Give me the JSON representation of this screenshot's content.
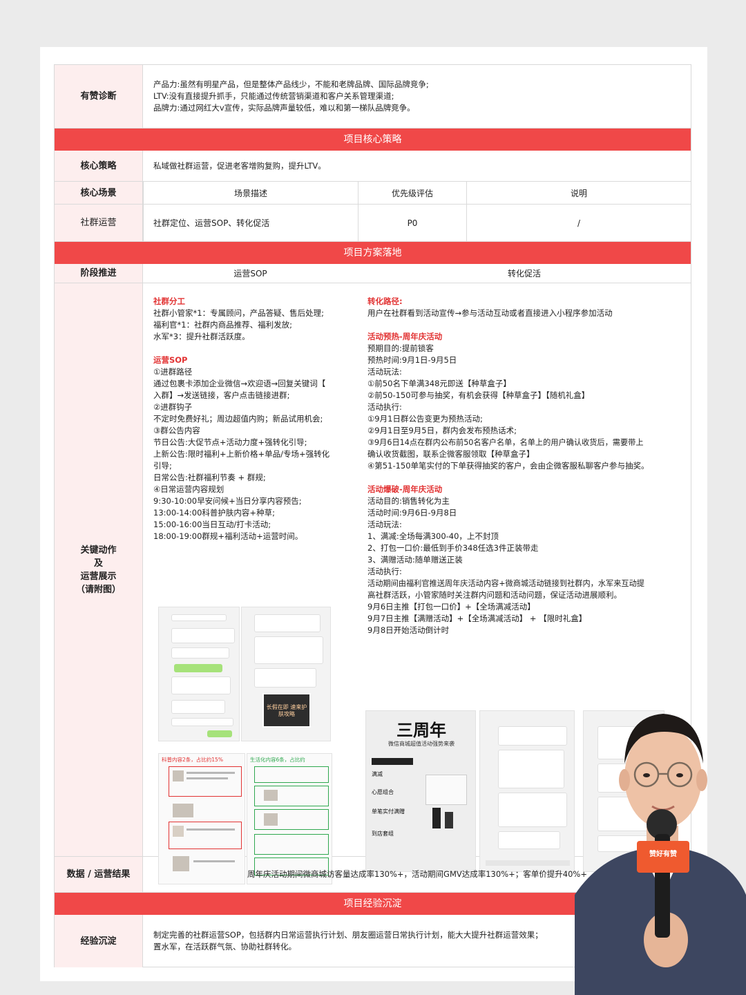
{
  "sections": {
    "diagnosis": {
      "label": "有赞诊断",
      "lines": [
        "产品力:虽然有明星产品，但是整体产品线少，不能和老牌品牌、国际品牌竞争;",
        "LTV:没有直接提升抓手，只能通过传统营销渠道和客户关系管理渠道;",
        "品牌力:通过网红大v宣传，实际品牌声量较低，难以和第一梯队品牌竞争。"
      ]
    },
    "banner_core": "项目核心策略",
    "core_strategy": {
      "label": "核心策略",
      "text": "私域做社群运营，促进老客增购复购，提升LTV。"
    },
    "core_scene": {
      "label": "核心场景",
      "headers": [
        "场景描述",
        "优先级评估",
        "说明"
      ],
      "row_label": "社群运营",
      "row_values": [
        "社群定位、运营SOP、转化促活",
        "P0",
        "/"
      ]
    },
    "banner_plan": "项目方案落地",
    "stage": {
      "label": "阶段推进",
      "col1": "运营SOP",
      "col2": "转化促活"
    },
    "key_actions": {
      "label_lines": [
        "关键动作",
        "及",
        "运营展示",
        "（请附图）"
      ],
      "left": {
        "title1": "社群分工",
        "division": [
          "社群小管家*1：专属顾问，产品答疑、售后处理;",
          "福利官*1：社群内商品推荐、福利发放;",
          "水军*3：提升社群活跃度。"
        ],
        "title2": "运营SOP",
        "sop": [
          "①进群路径",
          "通过包裹卡添加企业微信→欢迎语→回复关键词【",
          "入群】→发送链接，客户点击链接进群;",
          "②进群钩子",
          "不定时免费好礼；周边超值内购；新品试用机会;",
          "③群公告内容",
          "节日公告:大促节点+活动力度+强转化引导;",
          "上新公告:限时福利+上新价格+单品/专场+强转化",
          "引导;",
          "日常公告:社群福利节奏 + 群规;",
          "④日常运营内容规划",
          "9:30-10:00早安问候+当日分享内容预告;",
          "13:00-14:00科普护肤内容+种草;",
          "15:00-16:00当日互动/打卡活动;",
          "18:00-19:00群规+福利活动+运营时间。"
        ],
        "shot_tags": [
          "科普内容2条，占比约15%",
          "生活化内容6条，占比约"
        ],
        "shot_card": "长假在即 速来护肤攻略"
      },
      "right": {
        "title1": "转化路径:",
        "path": "用户在社群看到活动宣传→参与活动互动或者直接进入小程序参加活动",
        "title2": "活动预热-周年庆活动",
        "warmup": [
          "预期目的:提前锁客",
          "预热时间:9月1日-9月5日",
          "活动玩法:",
          "①前50名下单满348元即送【种草盒子】",
          "②前50-150可参与抽奖，有机会获得【种草盒子】【随机礼盒】",
          "活动执行:",
          "①9月1日群公告变更为预热活动;",
          "②9月1日至9月5日，群内会发布预热话术;",
          "③9月6日14点在群内公布前50名客户名单，名单上的用户确认收货后，需要带上",
          "确认收货截图，联系企微客服领取【种草盒子】",
          "④第51-150单笔实付的下单获得抽奖的客户，会由企微客服私聊客户参与抽奖。"
        ],
        "title3": "活动爆破-周年庆活动",
        "burst": [
          "活动目的:销售转化为主",
          "活动时间:9月6日-9月8日",
          "活动玩法:",
          "1、满减:全场每满300-40，上不封顶",
          "2、打包一口价:最低到手价348任选3件正装带走",
          "3、满赠活动:随单赠送正装",
          "活动执行:",
          "活动期间由福利官推送周年庆活动内容+微商城活动链接到社群内，水军来互动提",
          "高社群活跃，小管家随时关注群内问题和活动问题，保证活动进展顺利。",
          "9月6日主推【打包一口价】+【全场满减活动】",
          "9月7日主推【满赠活动】+【全场满减活动】 + 【限时礼盒】",
          "9月8日开始活动倒计时"
        ],
        "poster_title": "三周年",
        "poster_sub": "微信商城超值活动强势来袭",
        "poster_items": [
          "满减",
          "心愿组合",
          "单笔实付满赠",
          "到店套组"
        ]
      }
    },
    "result": {
      "label": "数据 / 运营结果",
      "text": "周年庆活动期间微商城访客量达成率130%+，活动期间GMV达成率130%+；客单价提升40%+"
    },
    "banner_exp": "项目经验沉淀",
    "experience": {
      "label": "经验沉淀",
      "lines": [
        "制定完善的社群运营SOP，包括群内日常运营执行计划、朋友圈运营日常执行计划，能大大提升社群运营效果；",
        "置水军，在活跃群气氛、协助社群转化。"
      ]
    },
    "presenter": {
      "mic_label": "赞好有赞"
    },
    "colors": {
      "banner": "#f04848",
      "label_bg": "#fdeeee",
      "accent_text": "#e23333"
    }
  }
}
